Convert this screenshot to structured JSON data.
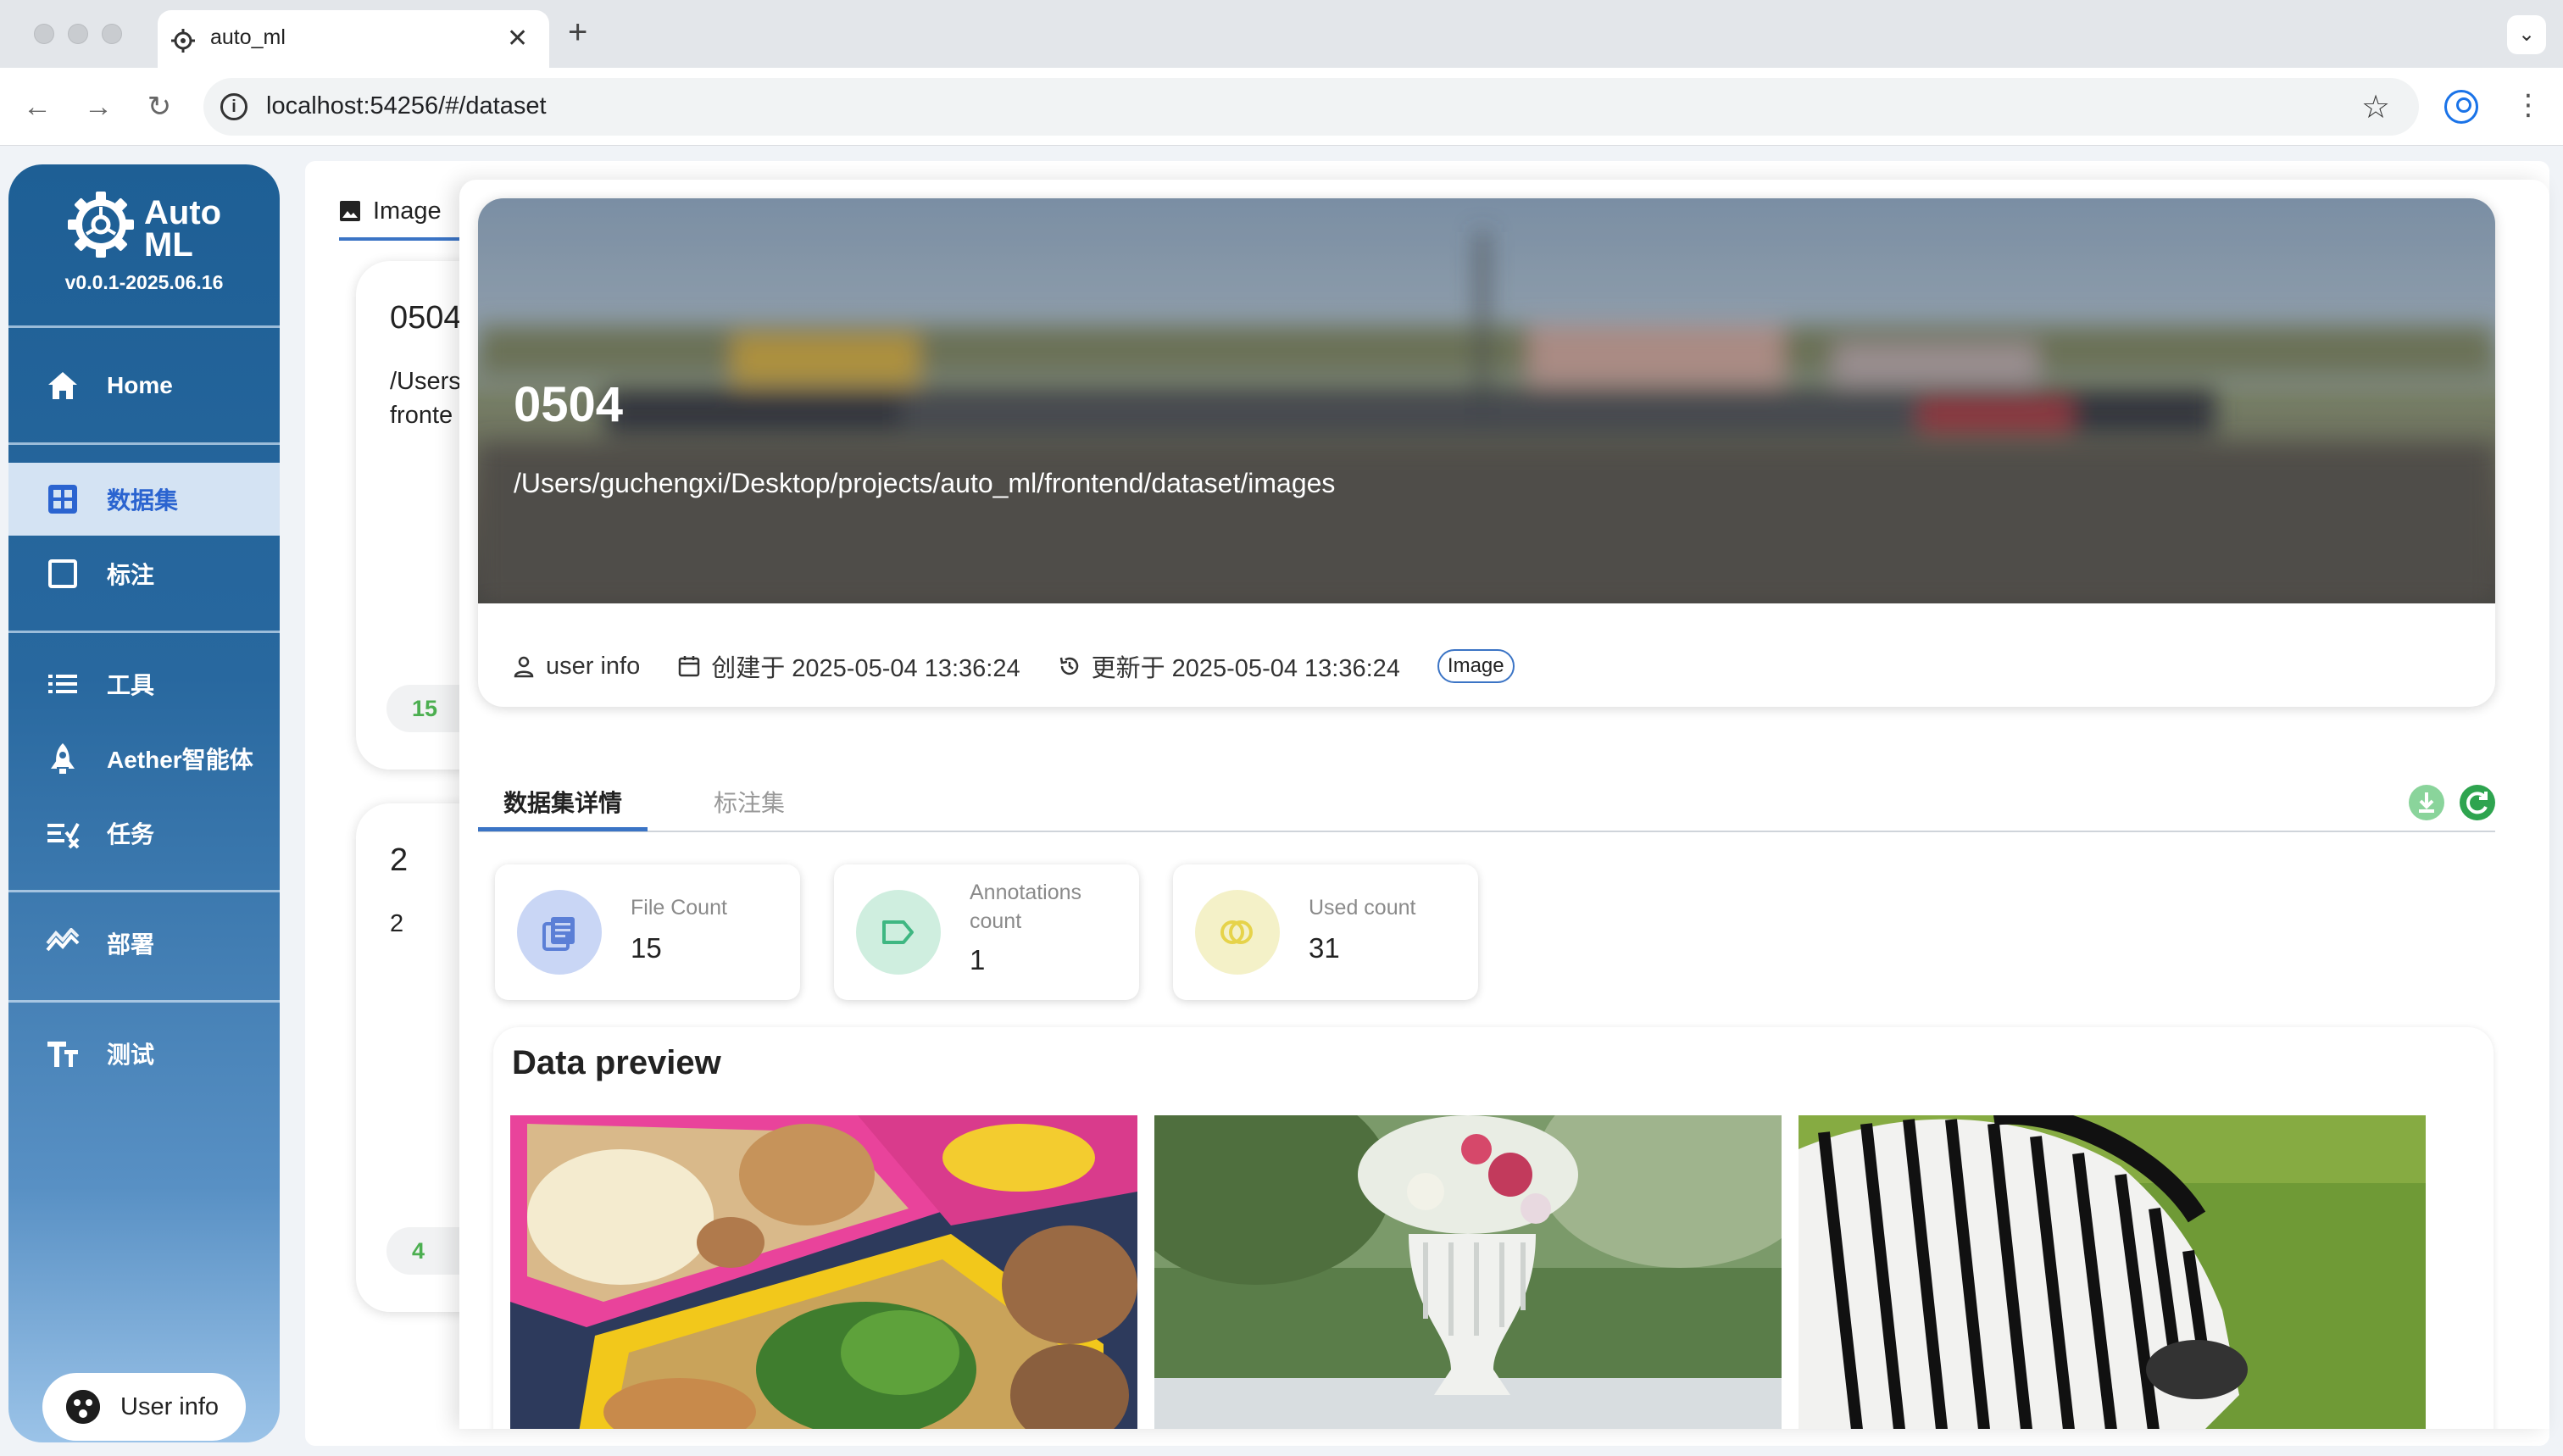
{
  "browser": {
    "tab_title": "auto_ml",
    "url": "localhost:54256/#/dataset"
  },
  "sidebar": {
    "logo_line1": "Auto",
    "logo_line2": "ML",
    "version": "v0.0.1-2025.06.16",
    "items": [
      {
        "label": "Home",
        "icon": "home-icon"
      },
      {
        "label": "数据集",
        "icon": "grid-icon",
        "active": true
      },
      {
        "label": "标注",
        "icon": "square-icon"
      },
      {
        "label": "工具",
        "icon": "list-icon"
      },
      {
        "label": "Aether智能体",
        "icon": "rocket-icon"
      },
      {
        "label": "任务",
        "icon": "task-icon"
      },
      {
        "label": "部署",
        "icon": "deploy-icon"
      },
      {
        "label": "测试",
        "icon": "text-icon"
      }
    ],
    "user_button": "User info"
  },
  "content": {
    "type_tab": "Image",
    "cards": [
      {
        "title": "0504",
        "path_line1": "/Users",
        "path_line2": "fronte",
        "chip": "15"
      },
      {
        "title": "2",
        "path_line1": "2",
        "chip": "4"
      }
    ]
  },
  "detail": {
    "title": "0504",
    "path": "/Users/guchengxi/Desktop/projects/auto_ml/frontend/dataset/images",
    "meta": {
      "user": "user info",
      "created": "创建于 2025-05-04 13:36:24",
      "updated": "更新于 2025-05-04 13:36:24",
      "type_badge": "Image"
    },
    "tabs": [
      "数据集详情",
      "标注集"
    ],
    "stats": [
      {
        "label": "File Count",
        "value": "15",
        "color": "#5b7fd6"
      },
      {
        "label_line1": "Annotations",
        "label_line2": "count",
        "value": "1",
        "color": "#3fb782"
      },
      {
        "label": "Used count",
        "value": "31",
        "color": "#e6d34a"
      }
    ],
    "preview_title": "Data preview"
  },
  "colors": {
    "accent": "#3b74c5",
    "sidebar_top": "#1e5f95",
    "sidebar_bottom": "#9bc3e8",
    "active_label": "#2b64d0"
  }
}
